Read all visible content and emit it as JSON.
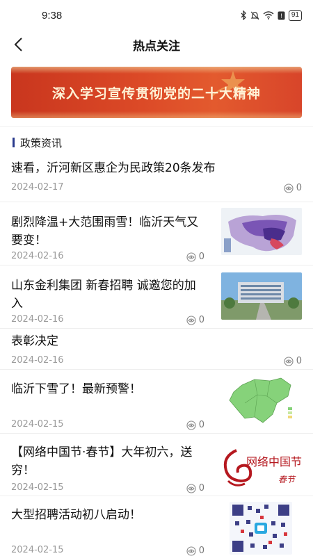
{
  "status": {
    "time": "9:38",
    "battery": "91"
  },
  "nav": {
    "title": "热点关注"
  },
  "banner": {
    "text": "深入学习宣传贯彻党的二十大精神"
  },
  "section": {
    "title": "政策资讯"
  },
  "news": [
    {
      "title": "速看，沂河新区惠企为民政策20条发布",
      "date": "2024-02-17",
      "views": "0"
    },
    {
      "title": "剧烈降温+大范围雨雪！临沂天气又要变！",
      "date": "2024-02-16",
      "views": "0"
    },
    {
      "title": "山东金利集团 新春招聘 诚邀您的加入",
      "date": "2024-02-16",
      "views": "0"
    },
    {
      "title": "表彰决定",
      "date": "2024-02-16",
      "views": "0"
    },
    {
      "title": "临沂下雪了！最新预警！",
      "date": "2024-02-15",
      "views": "0"
    },
    {
      "title": "【网络中国节·春节】大年初六，送穷！",
      "date": "2024-02-15",
      "views": "0"
    },
    {
      "title": "大型招聘活动初八启动！",
      "date": "2024-02-15",
      "views": "0"
    }
  ],
  "thumb_text": {
    "festival_main": "网络中国节",
    "festival_sub": "春节"
  },
  "icons": {
    "back": "chevron-left-icon",
    "views": "eye-icon",
    "section_marker": "bar-icon"
  },
  "colors": {
    "banner": "#d8452a",
    "section_bar": "#2a3a8c",
    "date": "#9a9a9a"
  }
}
